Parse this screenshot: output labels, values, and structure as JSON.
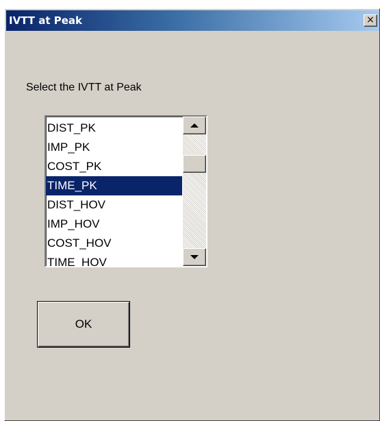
{
  "window": {
    "title": "IVTT at Peak",
    "close_label": "×"
  },
  "dialog": {
    "prompt": "Select the IVTT at Peak",
    "items": [
      {
        "label": "DIST_PK",
        "selected": false
      },
      {
        "label": "IMP_PK",
        "selected": false
      },
      {
        "label": "COST_PK",
        "selected": false
      },
      {
        "label": "TIME_PK",
        "selected": true
      },
      {
        "label": "DIST_HOV",
        "selected": false
      },
      {
        "label": "IMP_HOV",
        "selected": false
      },
      {
        "label": "COST_HOV",
        "selected": false
      },
      {
        "label": "TIME_HOV",
        "selected": false
      }
    ],
    "ok_label": "OK"
  },
  "colors": {
    "titlebar_start": "#0a246a",
    "titlebar_end": "#a6caf0",
    "window_bg": "#d4d0c8",
    "selection_bg": "#0a246a"
  }
}
